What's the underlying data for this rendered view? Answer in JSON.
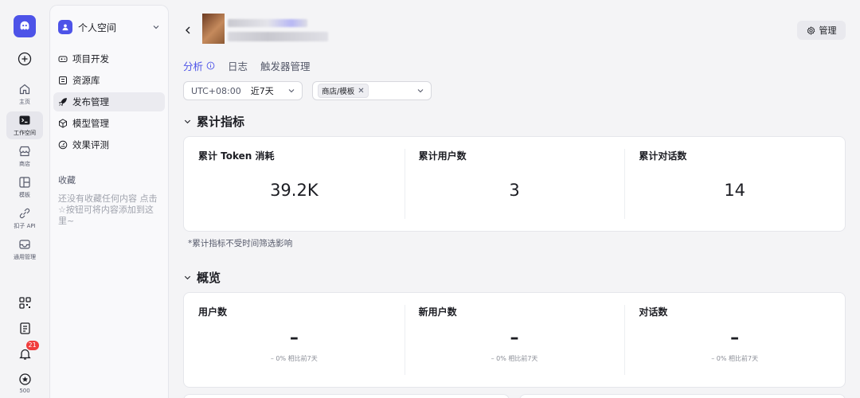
{
  "rail": {
    "items": [
      {
        "label": "主页",
        "icon": "home-icon"
      },
      {
        "label": "工作空间",
        "icon": "terminal-icon",
        "active": true
      },
      {
        "label": "商店",
        "icon": "store-icon"
      },
      {
        "label": "模板",
        "icon": "layout-icon"
      },
      {
        "label": "扣子 API",
        "icon": "link-icon"
      },
      {
        "label": "通用管理",
        "icon": "inbox-icon"
      }
    ],
    "notification_count": "21",
    "tail_label": "500"
  },
  "sidebar": {
    "space_label": "个人空间",
    "nav": [
      {
        "label": "项目开发",
        "icon": "gamepad-icon"
      },
      {
        "label": "资源库",
        "icon": "library-icon"
      },
      {
        "label": "发布管理",
        "icon": "rocket-icon",
        "active": true
      },
      {
        "label": "模型管理",
        "icon": "cube-icon"
      },
      {
        "label": "效果评测",
        "icon": "gauge-icon"
      }
    ],
    "favorites_title": "收藏",
    "favorites_empty": "还没有收藏任何内容 点击☆按钮可将内容添加到这里~"
  },
  "header": {
    "manage_label": "管理"
  },
  "tabs": [
    {
      "label": "分析",
      "active": true
    },
    {
      "label": "日志"
    },
    {
      "label": "触发器管理"
    }
  ],
  "filters": {
    "timezone": "UTC+08:00",
    "range": "近7天",
    "tag": "商店/模板"
  },
  "cumulative": {
    "title": "累计指标",
    "metrics": [
      {
        "label": "累计 Token 消耗",
        "value": "39.2K"
      },
      {
        "label": "累计用户数",
        "value": "3"
      },
      {
        "label": "累计对话数",
        "value": "14"
      }
    ],
    "note": "*累计指标不受时间筛选影响"
  },
  "overview": {
    "title": "概览",
    "metrics": [
      {
        "label": "用户数",
        "value": "–",
        "compare": "– 0%  相比前7天"
      },
      {
        "label": "新用户数",
        "value": "–",
        "compare": "– 0%  相比前7天"
      },
      {
        "label": "对话数",
        "value": "–",
        "compare": "– 0%  相比前7天"
      }
    ]
  },
  "colors": {
    "accent": "#4d53e8",
    "badge": "#f03d3d"
  }
}
